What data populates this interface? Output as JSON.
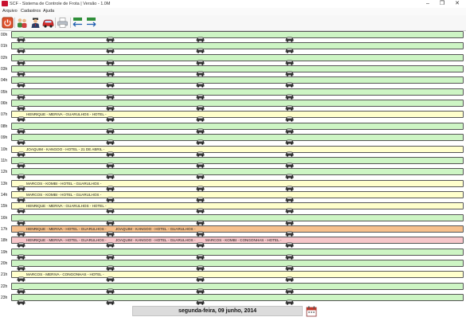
{
  "window": {
    "title": "SCF - Sistema de Controle de Frota | Versão - 1.0M",
    "controls": [
      "–",
      "❐",
      "✕"
    ]
  },
  "menu": [
    "Arquivo",
    "Cadastros",
    "Ajuda"
  ],
  "toolbar": {
    "buttons": [
      "power-icon",
      "users-icon",
      "driver-icon",
      "car-icon",
      "printer-icon",
      "import-icon",
      "export-icon"
    ]
  },
  "colors": {
    "free": "#cdf5c4",
    "booked": "#ffffcc",
    "busy": "#f6c08d",
    "conflict": "#f7c6ca"
  },
  "schedule": [
    {
      "hour": "00h",
      "status": "free",
      "slots": [
        "",
        "",
        "",
        ""
      ]
    },
    {
      "hour": "01h",
      "status": "free",
      "slots": [
        "",
        "",
        "",
        ""
      ]
    },
    {
      "hour": "02h",
      "status": "free",
      "slots": [
        "",
        "",
        "",
        ""
      ]
    },
    {
      "hour": "03h",
      "status": "free",
      "slots": [
        "",
        "",
        "",
        ""
      ]
    },
    {
      "hour": "04h",
      "status": "free",
      "slots": [
        "",
        "",
        "",
        ""
      ]
    },
    {
      "hour": "05h",
      "status": "free",
      "slots": [
        "",
        "",
        "",
        ""
      ]
    },
    {
      "hour": "06h",
      "status": "free",
      "slots": [
        "",
        "",
        "",
        ""
      ]
    },
    {
      "hour": "07h",
      "status": "booked",
      "slots": [
        "HENRIQUE - MERIVA - GUARULHOS - HOTEL -",
        "",
        "",
        ""
      ]
    },
    {
      "hour": "08h",
      "status": "free",
      "slots": [
        "",
        "",
        "",
        ""
      ]
    },
    {
      "hour": "09h",
      "status": "free",
      "slots": [
        "",
        "",
        "",
        ""
      ]
    },
    {
      "hour": "10h",
      "status": "booked",
      "slots": [
        "JOAQUIM - KANGOO - HOTEL - 21 DE ABRIL -",
        "",
        "",
        ""
      ]
    },
    {
      "hour": "11h",
      "status": "free",
      "slots": [
        "",
        "",
        "",
        ""
      ]
    },
    {
      "hour": "12h",
      "status": "free",
      "slots": [
        "",
        "",
        "",
        ""
      ]
    },
    {
      "hour": "13h",
      "status": "booked",
      "slots": [
        "MARCOS - KOMBI - HOTEL - GUARULHOS -",
        "",
        "",
        ""
      ]
    },
    {
      "hour": "14h",
      "status": "booked",
      "slots": [
        "MARCOS - KOMBI - HOTEL - GUARULHOS -",
        "",
        "",
        ""
      ]
    },
    {
      "hour": "15h",
      "status": "booked",
      "slots": [
        "HENRIQUE - MERIVA - GUARULHOS - HOTEL -",
        "",
        "",
        ""
      ]
    },
    {
      "hour": "16h",
      "status": "free",
      "slots": [
        "",
        "",
        "",
        ""
      ]
    },
    {
      "hour": "17h",
      "status": "busy",
      "slots": [
        "HENRIQUE - MERIVA - HOTEL - GUARULHOS -",
        "JOAQUIM - KANGOO - HOTEL - GUARULHOS -",
        "",
        ""
      ]
    },
    {
      "hour": "18h",
      "status": "conflict",
      "slots": [
        "HENRIQUE - MERIVA - HOTEL - GUARULHOS -",
        "JOAQUIM - KANGOO - HOTEL - GUARULHOS -",
        "MARCOS - KOMBI - CONGONHAS - HOTEL -",
        ""
      ]
    },
    {
      "hour": "19h",
      "status": "free",
      "slots": [
        "",
        "",
        "",
        ""
      ]
    },
    {
      "hour": "20h",
      "status": "free",
      "slots": [
        "",
        "",
        "",
        ""
      ]
    },
    {
      "hour": "21h",
      "status": "booked",
      "slots": [
        "MARCOS - MERIVA - CONGONHAS - HOTEL -",
        "",
        "",
        ""
      ]
    },
    {
      "hour": "22h",
      "status": "free",
      "slots": [
        "",
        "",
        "",
        ""
      ]
    },
    {
      "hour": "23h",
      "status": "free",
      "slots": [
        "",
        "",
        "",
        ""
      ]
    }
  ],
  "footer": {
    "date": "segunda-feira, 09 junho, 2014",
    "calendar_icon": "calendar-icon"
  }
}
